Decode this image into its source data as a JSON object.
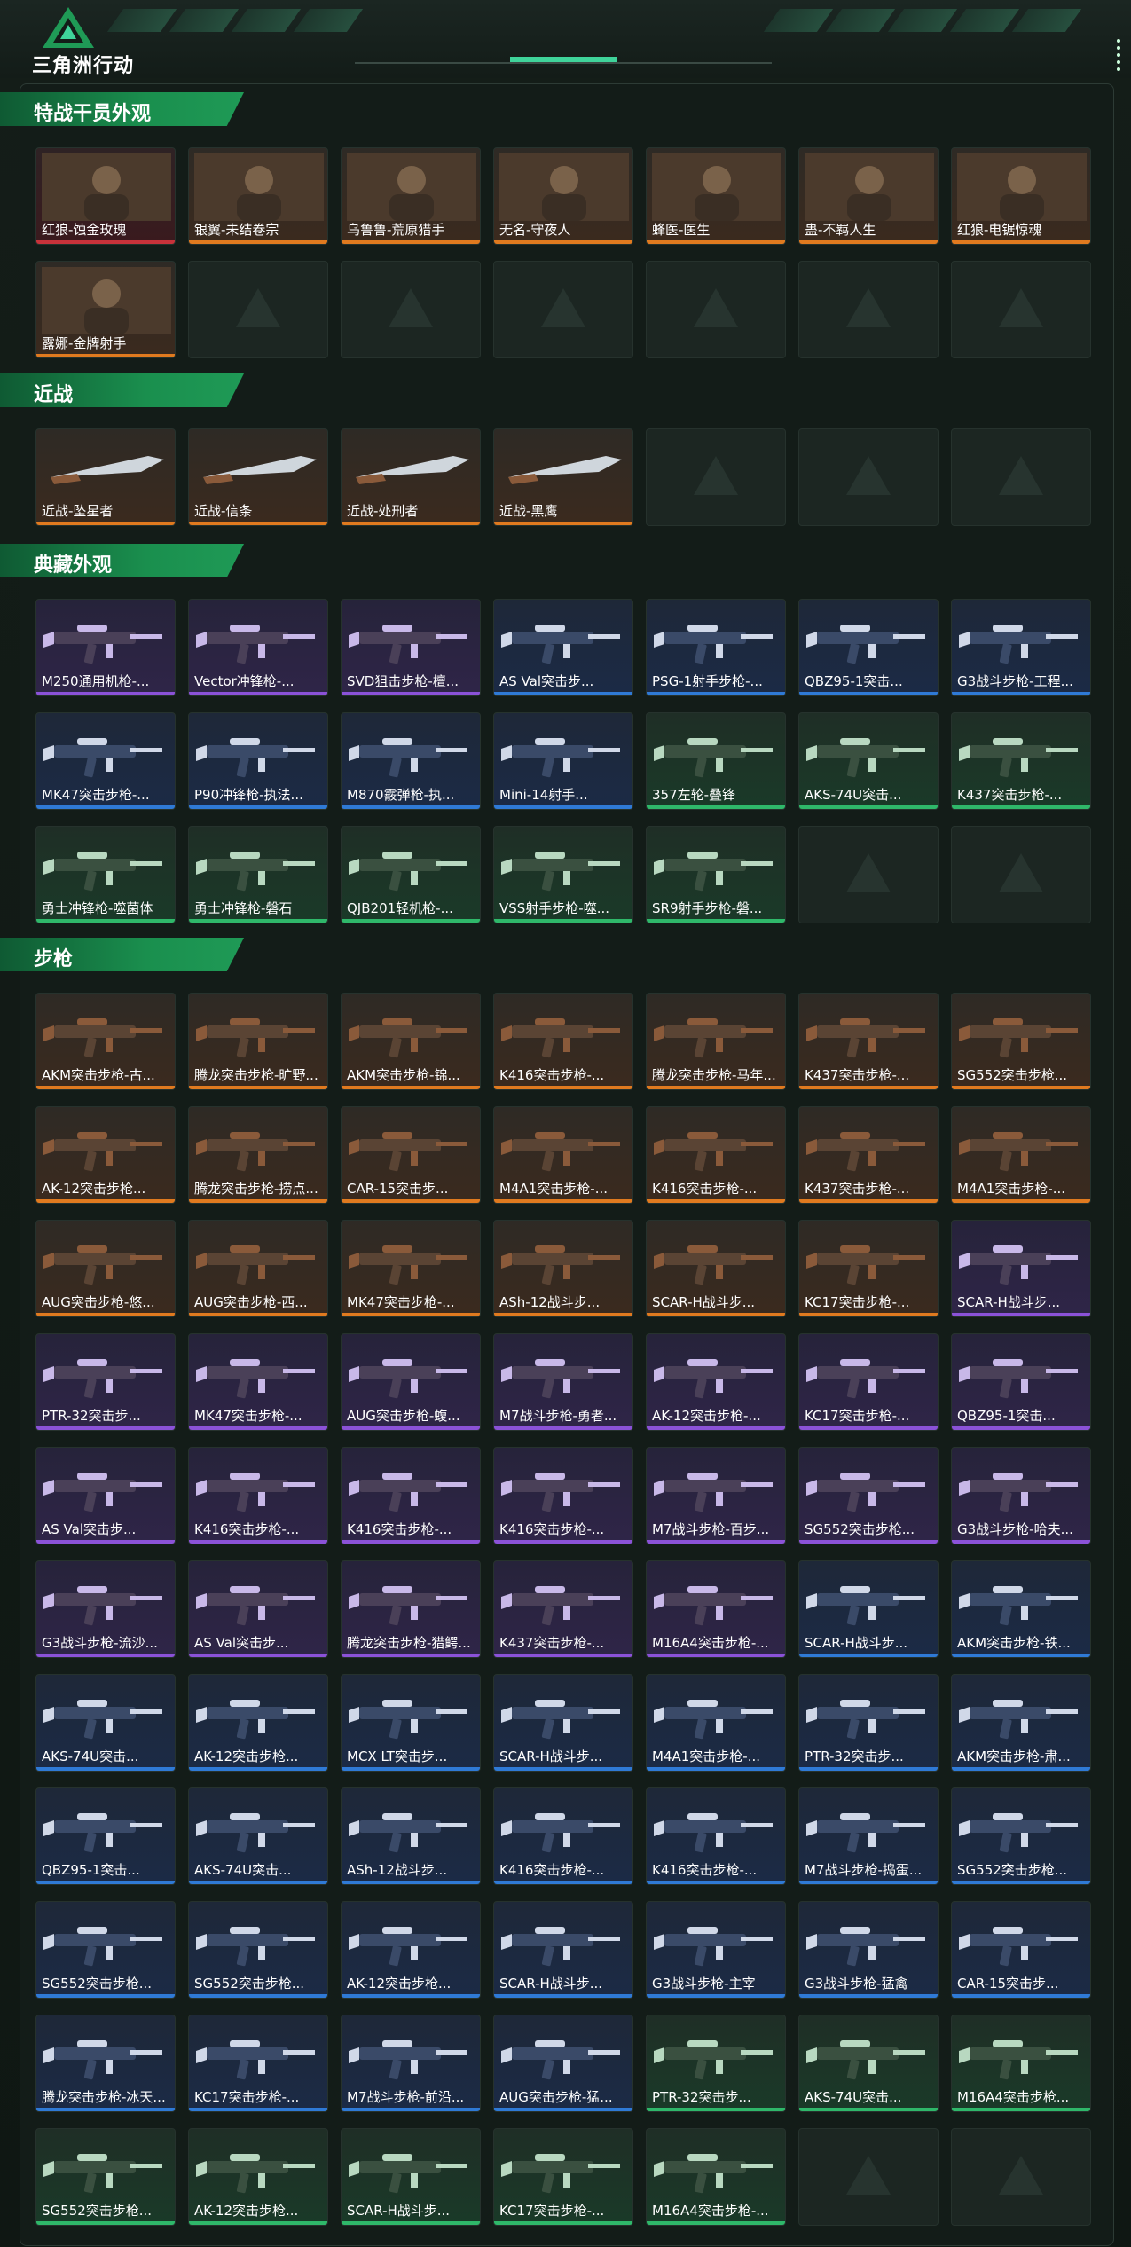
{
  "app": {
    "logo_text": "三角洲行动",
    "logo_icon": "delta-triangle-icon"
  },
  "colors": {
    "accent": "#1f9a56",
    "orange": "#e07a1f",
    "purple": "#8b52d8",
    "blue": "#2f7ad6",
    "green": "#2fb86a",
    "red": "#c8323a",
    "gold": "#c8a030"
  },
  "sections": [
    {
      "title": "特战干员外观",
      "rows": [
        [
          {
            "label": "红狼-蚀金玫瑰",
            "rarity": "red",
            "kind": "portrait",
            "badge": "蚀金玫瑰"
          },
          {
            "label": "银翼-未结卷宗",
            "rarity": "orange",
            "kind": "portrait",
            "badge": "未结卷宗"
          },
          {
            "label": "乌鲁鲁-荒原猎手",
            "rarity": "orange",
            "kind": "portrait",
            "badge": "荒原猎手"
          },
          {
            "label": "无名-守夜人",
            "rarity": "orange",
            "kind": "portrait",
            "badge": "守夜人"
          },
          {
            "label": "蜂医-医生",
            "rarity": "orange",
            "kind": "portrait",
            "badge": "医生"
          },
          {
            "label": "蛊-不羁人生",
            "rarity": "orange",
            "kind": "portrait",
            "badge": ""
          },
          {
            "label": "红狼-电锯惊魂",
            "rarity": "orange",
            "kind": "portrait",
            "badge": ""
          }
        ],
        [
          {
            "label": "露娜-金牌射手",
            "rarity": "orange",
            "kind": "portrait",
            "badge": ""
          },
          null,
          null,
          null,
          null,
          null,
          null
        ]
      ]
    },
    {
      "title": "近战",
      "rows": [
        [
          {
            "label": "近战-坠星者",
            "rarity": "orange",
            "kind": "knife"
          },
          {
            "label": "近战-信条",
            "rarity": "orange",
            "kind": "knife"
          },
          {
            "label": "近战-处刑者",
            "rarity": "orange",
            "kind": "knife"
          },
          {
            "label": "近战-黑鹰",
            "rarity": "orange",
            "kind": "knife"
          },
          null,
          null,
          null
        ]
      ]
    },
    {
      "title": "典藏外观",
      "rows": [
        [
          {
            "label": "M250通用机枪-...",
            "rarity": "purple",
            "kind": "gun"
          },
          {
            "label": "Vector冲锋枪-...",
            "rarity": "purple",
            "kind": "gun"
          },
          {
            "label": "SVD狙击步枪-檀...",
            "rarity": "purple",
            "kind": "gun"
          },
          {
            "label": "AS Val突击步...",
            "rarity": "blue",
            "kind": "gun"
          },
          {
            "label": "PSG-1射手步枪-...",
            "rarity": "blue",
            "kind": "gun"
          },
          {
            "label": "QBZ95-1突击...",
            "rarity": "blue",
            "kind": "gun"
          },
          {
            "label": "G3战斗步枪-工程...",
            "rarity": "blue",
            "kind": "gun"
          }
        ],
        [
          {
            "label": "MK47突击步枪-...",
            "rarity": "blue",
            "kind": "gun"
          },
          {
            "label": "P90冲锋枪-执法...",
            "rarity": "blue",
            "kind": "gun"
          },
          {
            "label": "M870霰弹枪-执...",
            "rarity": "blue",
            "kind": "gun"
          },
          {
            "label": "Mini-14射手...",
            "rarity": "blue",
            "kind": "gun"
          },
          {
            "label": "357左轮-叠锋",
            "rarity": "green",
            "kind": "gun"
          },
          {
            "label": "AKS-74U突击...",
            "rarity": "green",
            "kind": "gun"
          },
          {
            "label": "K437突击步枪-...",
            "rarity": "green",
            "kind": "gun"
          }
        ],
        [
          {
            "label": "勇士冲锋枪-噬菌体",
            "rarity": "green",
            "kind": "gun"
          },
          {
            "label": "勇士冲锋枪-磐石",
            "rarity": "green",
            "kind": "gun"
          },
          {
            "label": "QJB201轻机枪-...",
            "rarity": "green",
            "kind": "gun"
          },
          {
            "label": "VSS射手步枪-噬...",
            "rarity": "green",
            "kind": "gun"
          },
          {
            "label": "SR9射手步枪-磐...",
            "rarity": "green",
            "kind": "gun"
          },
          null,
          null
        ]
      ]
    },
    {
      "title": "步枪",
      "rows": [
        [
          {
            "label": "AKM突击步枪-古...",
            "rarity": "orange",
            "kind": "gun"
          },
          {
            "label": "腾龙突击步枪-旷野...",
            "rarity": "orange",
            "kind": "gun"
          },
          {
            "label": "AKM突击步枪-锦...",
            "rarity": "orange",
            "kind": "gun"
          },
          {
            "label": "K416突击步枪-...",
            "rarity": "orange",
            "kind": "gun"
          },
          {
            "label": "腾龙突击步枪-马年...",
            "rarity": "orange",
            "kind": "gun"
          },
          {
            "label": "K437突击步枪-...",
            "rarity": "orange",
            "kind": "gun"
          },
          {
            "label": "SG552突击步枪...",
            "rarity": "orange",
            "kind": "gun"
          }
        ],
        [
          {
            "label": "AK-12突击步枪...",
            "rarity": "orange",
            "kind": "gun"
          },
          {
            "label": "腾龙突击步枪-捞点...",
            "rarity": "orange",
            "kind": "gun"
          },
          {
            "label": "CAR-15突击步...",
            "rarity": "orange",
            "kind": "gun"
          },
          {
            "label": "M4A1突击步枪-...",
            "rarity": "orange",
            "kind": "gun"
          },
          {
            "label": "K416突击步枪-...",
            "rarity": "orange",
            "kind": "gun"
          },
          {
            "label": "K437突击步枪-...",
            "rarity": "orange",
            "kind": "gun"
          },
          {
            "label": "M4A1突击步枪-...",
            "rarity": "orange",
            "kind": "gun"
          }
        ],
        [
          {
            "label": "AUG突击步枪-悠...",
            "rarity": "orange",
            "kind": "gun"
          },
          {
            "label": "AUG突击步枪-西...",
            "rarity": "orange",
            "kind": "gun"
          },
          {
            "label": "MK47突击步枪-...",
            "rarity": "orange",
            "kind": "gun"
          },
          {
            "label": "ASh-12战斗步...",
            "rarity": "orange",
            "kind": "gun"
          },
          {
            "label": "SCAR-H战斗步...",
            "rarity": "orange",
            "kind": "gun"
          },
          {
            "label": "KC17突击步枪-...",
            "rarity": "orange",
            "kind": "gun"
          },
          {
            "label": "SCAR-H战斗步...",
            "rarity": "purple",
            "kind": "gun"
          }
        ],
        [
          {
            "label": "PTR-32突击步...",
            "rarity": "purple",
            "kind": "gun"
          },
          {
            "label": "MK47突击步枪-...",
            "rarity": "purple",
            "kind": "gun"
          },
          {
            "label": "AUG突击步枪-蝮...",
            "rarity": "purple",
            "kind": "gun"
          },
          {
            "label": "M7战斗步枪-勇者...",
            "rarity": "purple",
            "kind": "gun"
          },
          {
            "label": "AK-12突击步枪-...",
            "rarity": "purple",
            "kind": "gun"
          },
          {
            "label": "KC17突击步枪-...",
            "rarity": "purple",
            "kind": "gun"
          },
          {
            "label": "QBZ95-1突击...",
            "rarity": "purple",
            "kind": "gun"
          }
        ],
        [
          {
            "label": "AS Val突击步...",
            "rarity": "purple",
            "kind": "gun"
          },
          {
            "label": "K416突击步枪-...",
            "rarity": "purple",
            "kind": "gun"
          },
          {
            "label": "K416突击步枪-...",
            "rarity": "purple",
            "kind": "gun"
          },
          {
            "label": "K416突击步枪-...",
            "rarity": "purple",
            "kind": "gun"
          },
          {
            "label": "M7战斗步枪-百步...",
            "rarity": "purple",
            "kind": "gun"
          },
          {
            "label": "SG552突击步枪...",
            "rarity": "purple",
            "kind": "gun"
          },
          {
            "label": "G3战斗步枪-哈夫...",
            "rarity": "purple",
            "kind": "gun"
          }
        ],
        [
          {
            "label": "G3战斗步枪-流沙...",
            "rarity": "purple",
            "kind": "gun"
          },
          {
            "label": "AS Val突击步...",
            "rarity": "purple",
            "kind": "gun"
          },
          {
            "label": "腾龙突击步枪-猎鳄...",
            "rarity": "purple",
            "kind": "gun"
          },
          {
            "label": "K437突击步枪-...",
            "rarity": "purple",
            "kind": "gun"
          },
          {
            "label": "M16A4突击步枪-...",
            "rarity": "purple",
            "kind": "gun"
          },
          {
            "label": "SCAR-H战斗步...",
            "rarity": "blue",
            "kind": "gun"
          },
          {
            "label": "AKM突击步枪-铁...",
            "rarity": "blue",
            "kind": "gun"
          }
        ],
        [
          {
            "label": "AKS-74U突击...",
            "rarity": "blue",
            "kind": "gun"
          },
          {
            "label": "AK-12突击步枪...",
            "rarity": "blue",
            "kind": "gun"
          },
          {
            "label": "MCX LT突击步...",
            "rarity": "blue",
            "kind": "gun"
          },
          {
            "label": "SCAR-H战斗步...",
            "rarity": "blue",
            "kind": "gun"
          },
          {
            "label": "M4A1突击步枪-...",
            "rarity": "blue",
            "kind": "gun"
          },
          {
            "label": "PTR-32突击步...",
            "rarity": "blue",
            "kind": "gun"
          },
          {
            "label": "AKM突击步枪-肃...",
            "rarity": "blue",
            "kind": "gun"
          }
        ],
        [
          {
            "label": "QBZ95-1突击...",
            "rarity": "blue",
            "kind": "gun"
          },
          {
            "label": "AKS-74U突击...",
            "rarity": "blue",
            "kind": "gun"
          },
          {
            "label": "ASh-12战斗步...",
            "rarity": "blue",
            "kind": "gun"
          },
          {
            "label": "K416突击步枪-...",
            "rarity": "blue",
            "kind": "gun"
          },
          {
            "label": "K416突击步枪-...",
            "rarity": "blue",
            "kind": "gun"
          },
          {
            "label": "M7战斗步枪-捣蛋...",
            "rarity": "blue",
            "kind": "gun"
          },
          {
            "label": "SG552突击步枪...",
            "rarity": "blue",
            "kind": "gun"
          }
        ],
        [
          {
            "label": "SG552突击步枪...",
            "rarity": "blue",
            "kind": "gun"
          },
          {
            "label": "SG552突击步枪...",
            "rarity": "blue",
            "kind": "gun"
          },
          {
            "label": "AK-12突击步枪...",
            "rarity": "blue",
            "kind": "gun"
          },
          {
            "label": "SCAR-H战斗步...",
            "rarity": "blue",
            "kind": "gun"
          },
          {
            "label": "G3战斗步枪-主宰",
            "rarity": "blue",
            "kind": "gun"
          },
          {
            "label": "G3战斗步枪-猛禽",
            "rarity": "blue",
            "kind": "gun"
          },
          {
            "label": "CAR-15突击步...",
            "rarity": "blue",
            "kind": "gun"
          }
        ],
        [
          {
            "label": "腾龙突击步枪-冰天...",
            "rarity": "blue",
            "kind": "gun"
          },
          {
            "label": "KC17突击步枪-...",
            "rarity": "blue",
            "kind": "gun"
          },
          {
            "label": "M7战斗步枪-前沿...",
            "rarity": "blue",
            "kind": "gun"
          },
          {
            "label": "AUG突击步枪-猛...",
            "rarity": "blue",
            "kind": "gun"
          },
          {
            "label": "PTR-32突击步...",
            "rarity": "green",
            "kind": "gun"
          },
          {
            "label": "AKS-74U突击...",
            "rarity": "green",
            "kind": "gun"
          },
          {
            "label": "M16A4突击步枪...",
            "rarity": "green",
            "kind": "gun"
          }
        ],
        [
          {
            "label": "SG552突击步枪...",
            "rarity": "green",
            "kind": "gun"
          },
          {
            "label": "AK-12突击步枪...",
            "rarity": "green",
            "kind": "gun"
          },
          {
            "label": "SCAR-H战斗步...",
            "rarity": "green",
            "kind": "gun"
          },
          {
            "label": "KC17突击步枪-...",
            "rarity": "green",
            "kind": "gun"
          },
          {
            "label": "M16A4突击步枪-...",
            "rarity": "green",
            "kind": "gun"
          },
          null,
          null
        ]
      ]
    }
  ]
}
